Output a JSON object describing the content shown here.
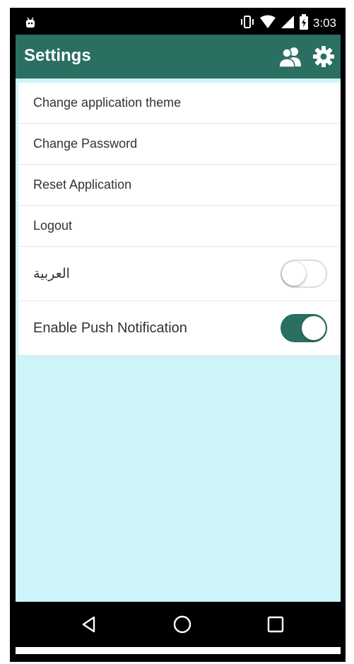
{
  "status_bar": {
    "time": "3:03",
    "icons": [
      "android-debug-icon",
      "vibrate-icon",
      "wifi-icon",
      "signal-icon",
      "battery-charging-icon"
    ]
  },
  "app_bar": {
    "title": "Settings",
    "actions": [
      "users-icon",
      "gear-icon"
    ]
  },
  "settings": {
    "items": [
      {
        "label": "Change application theme"
      },
      {
        "label": "Change Password"
      },
      {
        "label": "Reset Application"
      },
      {
        "label": "Logout"
      }
    ],
    "language_toggle": {
      "label": "العربية",
      "enabled": false
    },
    "push_toggle": {
      "label": "Enable Push Notification",
      "enabled": true
    }
  },
  "nav_bar": {
    "buttons": [
      "back-icon",
      "home-icon",
      "recents-icon"
    ]
  },
  "colors": {
    "primary": "#2a6f62",
    "content_background": "#cdf4f9",
    "list_background": "#ffffff",
    "text": "#333333"
  }
}
